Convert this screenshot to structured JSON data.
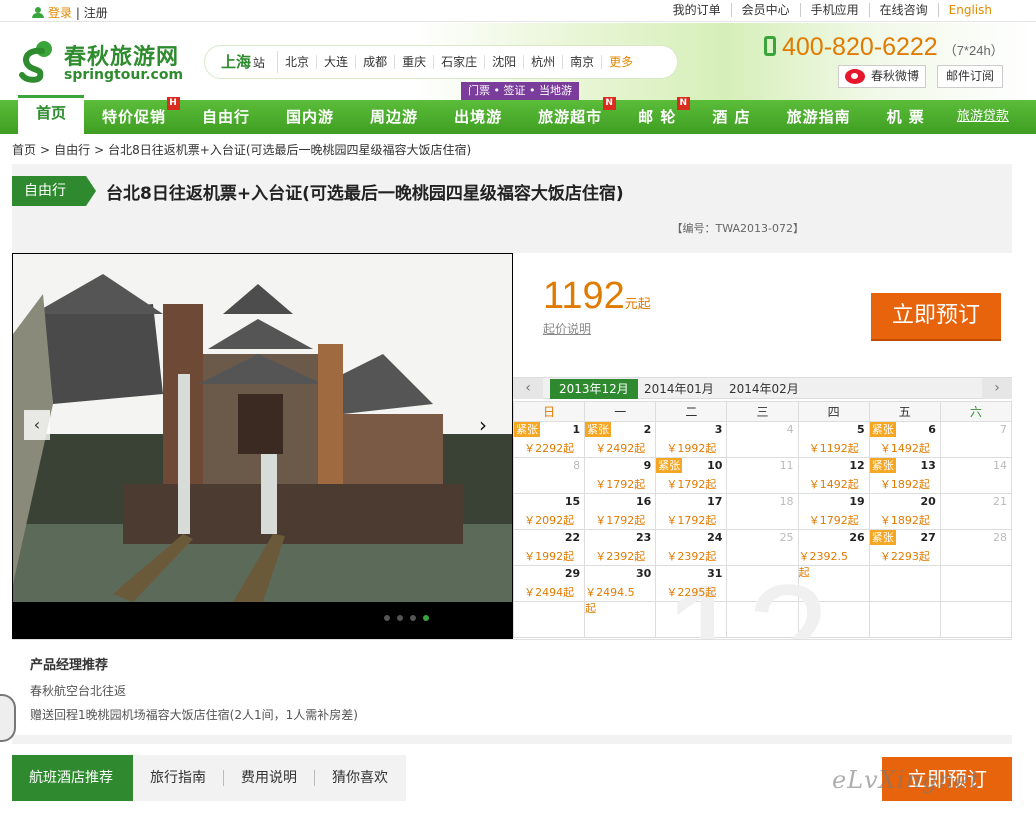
{
  "topbar": {
    "login": "登录",
    "register": "注册",
    "links": [
      "我的订单",
      "会员中心",
      "手机应用",
      "在线咨询"
    ],
    "english": "English"
  },
  "logo": {
    "cn": "春秋旅游网",
    "en": "springtour.com"
  },
  "city": {
    "current": "上海",
    "station": "站",
    "list": [
      "北京",
      "大连",
      "成都",
      "重庆",
      "石家庄",
      "沈阳",
      "杭州",
      "南京"
    ],
    "more": "更多"
  },
  "ticket_ad": "门票 • 签证 • 当地游",
  "phone": {
    "number": "400-820-6222",
    "hours": "（7*24h）"
  },
  "weibo": "春秋微博",
  "mail": "邮件订阅",
  "nav": {
    "home": "首页",
    "items": [
      {
        "label": "特价促销",
        "badge": "H"
      },
      {
        "label": "自由行",
        "badge": ""
      },
      {
        "label": "国内游",
        "badge": ""
      },
      {
        "label": "周边游",
        "badge": ""
      },
      {
        "label": "出境游",
        "badge": ""
      },
      {
        "label": "旅游超市",
        "badge": "N"
      },
      {
        "label": "邮 轮",
        "badge": "N"
      },
      {
        "label": "酒 店",
        "badge": ""
      },
      {
        "label": "旅游指南",
        "badge": ""
      },
      {
        "label": "机 票",
        "badge": ""
      }
    ],
    "loan": "旅游贷款"
  },
  "breadcrumb": {
    "home": "首页",
    "cat": "自由行",
    "current": "台北8日往返机票+入台证(可选最后一晚桃园四星级福容大饭店住宿)"
  },
  "product": {
    "tag": "自由行",
    "title": "台北8日往返机票+入台证(可选最后一晚桃园四星级福容大饭店住宿)",
    "code": "【编号：TWA2013-072】",
    "price": "1192",
    "price_unit": "元起",
    "price_link": "起价说明",
    "book": "立即预订"
  },
  "calendar": {
    "months": [
      "2013年12月",
      "2014年01月",
      "2014年02月"
    ],
    "weekdays": [
      "日",
      "一",
      "二",
      "三",
      "四",
      "五",
      "六"
    ],
    "tight_label": "紧张",
    "watermark": "12",
    "cells": [
      {
        "d": "1",
        "p": "￥2292起",
        "t": true
      },
      {
        "d": "2",
        "p": "￥2492起",
        "t": true
      },
      {
        "d": "3",
        "p": "￥1992起",
        "t": false
      },
      {
        "d": "4",
        "p": "",
        "t": false,
        "g": true
      },
      {
        "d": "5",
        "p": "￥1192起",
        "t": false
      },
      {
        "d": "6",
        "p": "￥1492起",
        "t": true
      },
      {
        "d": "7",
        "p": "",
        "t": false,
        "g": true
      },
      {
        "d": "8",
        "p": "",
        "t": false,
        "g": true
      },
      {
        "d": "9",
        "p": "￥1792起",
        "t": false
      },
      {
        "d": "10",
        "p": "￥1792起",
        "t": true
      },
      {
        "d": "11",
        "p": "",
        "t": false,
        "g": true
      },
      {
        "d": "12",
        "p": "￥1492起",
        "t": false
      },
      {
        "d": "13",
        "p": "￥1892起",
        "t": true
      },
      {
        "d": "14",
        "p": "",
        "t": false,
        "g": true
      },
      {
        "d": "15",
        "p": "￥2092起",
        "t": false
      },
      {
        "d": "16",
        "p": "￥1792起",
        "t": false
      },
      {
        "d": "17",
        "p": "￥1792起",
        "t": false
      },
      {
        "d": "18",
        "p": "",
        "t": false,
        "g": true
      },
      {
        "d": "19",
        "p": "￥1792起",
        "t": false
      },
      {
        "d": "20",
        "p": "￥1892起",
        "t": false
      },
      {
        "d": "21",
        "p": "",
        "t": false,
        "g": true
      },
      {
        "d": "22",
        "p": "￥1992起",
        "t": false
      },
      {
        "d": "23",
        "p": "￥2392起",
        "t": false
      },
      {
        "d": "24",
        "p": "￥2392起",
        "t": false
      },
      {
        "d": "25",
        "p": "",
        "t": false,
        "g": true
      },
      {
        "d": "26",
        "p": "￥2392.5起",
        "t": false
      },
      {
        "d": "27",
        "p": "￥2293起",
        "t": true
      },
      {
        "d": "28",
        "p": "",
        "t": false,
        "g": true
      },
      {
        "d": "29",
        "p": "￥2494起",
        "t": false
      },
      {
        "d": "30",
        "p": "￥2494.5起",
        "t": false
      },
      {
        "d": "31",
        "p": "￥2295起",
        "t": false
      },
      {
        "d": "",
        "p": "",
        "t": false
      },
      {
        "d": "",
        "p": "",
        "t": false
      },
      {
        "d": "",
        "p": "",
        "t": false
      },
      {
        "d": "",
        "p": "",
        "t": false
      },
      {
        "d": "",
        "p": "",
        "t": false
      },
      {
        "d": "",
        "p": "",
        "t": false
      },
      {
        "d": "",
        "p": "",
        "t": false
      },
      {
        "d": "",
        "p": "",
        "t": false
      },
      {
        "d": "",
        "p": "",
        "t": false
      },
      {
        "d": "",
        "p": "",
        "t": false
      },
      {
        "d": "",
        "p": "",
        "t": false
      }
    ]
  },
  "recommend": {
    "title": "产品经理推荐",
    "line1": "春秋航空台北往返",
    "line2": "赠送回程1晚桃园机场福容大饭店住宿(2人1间，1人需补房差)"
  },
  "tabs": [
    "航班酒店推荐",
    "旅行指南",
    "费用说明",
    "猜你喜欢"
  ],
  "book2": "立即预订",
  "watermark": "eLvXingnet",
  "colors": {
    "green": "#2f8a2f",
    "orange": "#e8640c",
    "price": "#e07b00"
  }
}
